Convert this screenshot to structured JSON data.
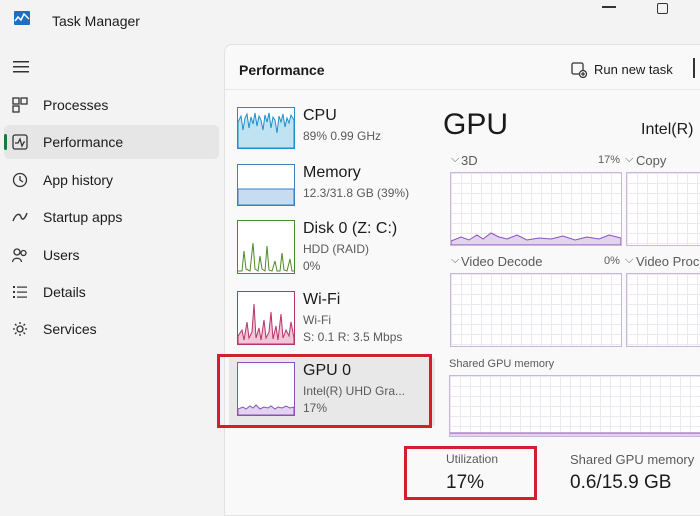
{
  "window": {
    "title": "Task Manager"
  },
  "nav": {
    "items": [
      {
        "label": "Processes",
        "icon": "processes-icon",
        "active": false
      },
      {
        "label": "Performance",
        "icon": "performance-icon",
        "active": true
      },
      {
        "label": "App history",
        "icon": "history-icon",
        "active": false
      },
      {
        "label": "Startup apps",
        "icon": "startup-icon",
        "active": false
      },
      {
        "label": "Users",
        "icon": "users-icon",
        "active": false
      },
      {
        "label": "Details",
        "icon": "details-icon",
        "active": false
      },
      {
        "label": "Services",
        "icon": "services-icon",
        "active": false
      }
    ]
  },
  "header": {
    "title": "Performance",
    "run_new_task": "Run new task"
  },
  "devices": [
    {
      "name": "CPU",
      "line1": "89% 0.99 GHz",
      "line2": "",
      "color": "#1e8fc7"
    },
    {
      "name": "Memory",
      "line1": "12.3/31.8 GB (39%)",
      "line2": "",
      "color": "#3e7fc4"
    },
    {
      "name": "Disk 0 (Z: C:)",
      "line1": "HDD (RAID)",
      "line2": "0%",
      "color": "#4f8a2a"
    },
    {
      "name": "Wi-Fi",
      "line1": "Wi-Fi",
      "line2": "S: 0.1 R: 3.5 Mbps",
      "color": "#b8336a"
    },
    {
      "name": "GPU 0",
      "line1": "Intel(R) UHD Gra...",
      "line2": "17%",
      "color": "#8c4fbf"
    }
  ],
  "detail": {
    "title": "GPU",
    "model": "Intel(R)",
    "engines": [
      {
        "label": "3D",
        "pct": "17%"
      },
      {
        "label": "Copy",
        "pct": ""
      },
      {
        "label": "Video Decode",
        "pct": "0%"
      },
      {
        "label": "Video Proc",
        "pct": ""
      }
    ],
    "shared_gpu_memory_label": "Shared GPU memory",
    "stats": {
      "utilization_label": "Utilization",
      "utilization_value": "17%",
      "shared_memory_label": "Shared GPU memory",
      "shared_memory_value": "0.6/15.9 GB"
    }
  },
  "colors": {
    "highlight": "#d21f2f",
    "active_nav_bar": "#1b7a3a",
    "gpu_graph": "#8c4fbf"
  }
}
